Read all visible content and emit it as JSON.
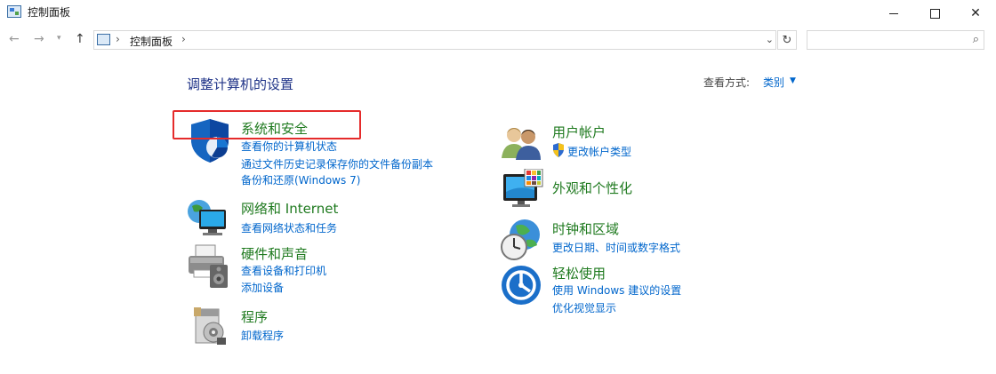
{
  "window": {
    "title": "控制面板"
  },
  "nav": {
    "back_icon": "back-arrow-icon",
    "forward_icon": "forward-arrow-icon",
    "up_icon": "up-arrow-icon"
  },
  "address": {
    "path": "控制面板"
  },
  "search": {
    "value": "",
    "placeholder": ""
  },
  "heading": "调整计算机的设置",
  "view": {
    "label": "查看方式:",
    "value": "类别"
  },
  "left_categories": [
    {
      "title": "系统和安全",
      "icon": "shield-icon",
      "links": [
        "查看你的计算机状态",
        "通过文件历史记录保存你的文件备份副本",
        "备份和还原(Windows 7)"
      ]
    },
    {
      "title": "网络和 Internet",
      "icon": "network-icon",
      "links": [
        "查看网络状态和任务"
      ]
    },
    {
      "title": "硬件和声音",
      "icon": "printer-icon",
      "links": [
        "查看设备和打印机",
        "添加设备"
      ]
    },
    {
      "title": "程序",
      "icon": "programs-icon",
      "links": [
        "卸载程序"
      ]
    }
  ],
  "right_categories": [
    {
      "title": "用户帐户",
      "icon": "users-icon",
      "links": [
        "更改帐户类型"
      ]
    },
    {
      "title": "外观和个性化",
      "icon": "monitor-icon",
      "links": []
    },
    {
      "title": "时钟和区域",
      "icon": "clock-globe-icon",
      "links": [
        "更改日期、时间或数字格式"
      ]
    },
    {
      "title": "轻松使用",
      "icon": "ease-of-access-icon",
      "links": [
        "使用 Windows 建议的设置",
        "优化视觉显示"
      ]
    }
  ],
  "colors": {
    "title_green": "#1f7a1f",
    "link_blue": "#0066cc",
    "heading_navy": "#1e3287",
    "highlight_red": "#e52b2b"
  }
}
